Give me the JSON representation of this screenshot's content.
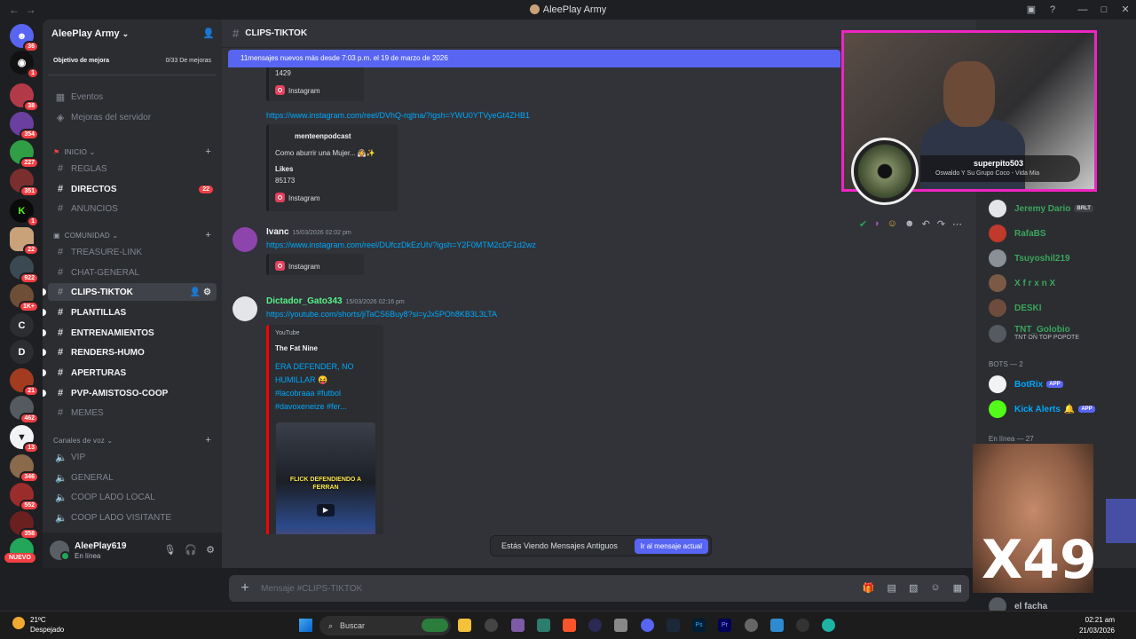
{
  "window": {
    "title": "AleePlay Army"
  },
  "server": {
    "name": "AleePlay Army",
    "boost_label": "Objetivo de mejora",
    "boost_progress": "0/33 De mejoras"
  },
  "sidebar": {
    "events": "Eventos",
    "improvements": "Mejoras del servidor",
    "cat_inicio": "INICIO",
    "cat_comunidad": "COMUNIDAD",
    "cat_voice": "Canales de voz",
    "channels": {
      "reglas": "REGLAS",
      "directos": "DIRECTOS",
      "directos_badge": "22",
      "anuncios": "ANUNCIOS",
      "treasure": "TREASURE-LINK",
      "chat": "CHAT-GENERAL",
      "clips": "CLIPS-TIKTOK",
      "plantillas": "PLANTILLAS",
      "entrenamientos": "ENTRENAMIENTOS",
      "renders": "RENDERS-HUMO",
      "aperturas": "APERTURAS",
      "pvp": "PVP-AMISTOSO-COOP",
      "memes": "MEMES"
    },
    "voice": {
      "vip": "VIP",
      "general": "GENERAL",
      "local": "COOP LADO LOCAL",
      "visitante": "COOP LADO VISITANTE"
    },
    "user": {
      "name": "AleePlay619",
      "status": "En línea"
    }
  },
  "guilds": {
    "badges": [
      "36",
      "1",
      "38",
      "354",
      "227",
      "351",
      "1",
      "22",
      "922",
      "1K+",
      "21",
      "462",
      "13",
      "346",
      "552",
      "358"
    ],
    "letters": [
      "C",
      "D"
    ],
    "nuevo": "NUEVO"
  },
  "channel": {
    "name": "CLIPS-TIKTOK",
    "new_banner": "11mensajes nuevos más desde 7:03 p.m. el 19 de marzo de 2026",
    "composer_placeholder": "Mensaje #CLIPS-TIKTOK",
    "toast_text": "Estás Viendo Mensajes Antiguos",
    "toast_button": "Ir al mensaje actual"
  },
  "messages": {
    "top_likes": "1429",
    "instagram": "Instagram",
    "link1": "https://www.instagram.com/reel/DVhQ-rqjtna/?igsh=YWU0YTVyeGt4ZHB1",
    "embed1_author": "menteenpodcast",
    "embed1_desc": "Como aburrir una Mujer... 👰‍♀️✨",
    "embed1_likes_label": "Likes",
    "embed1_likes": "85173",
    "m2_author": "Ivanc",
    "m2_time": "15/03/2026 02:02 pm",
    "link2": "https://www.instagram.com/reel/DUfczDkEzUh/?igsh=Y2F0MTM2cDF1d2wz",
    "m3_author": "Dictador_Gato343",
    "m3_time": "15/03/2026 02:16 pm",
    "link3": "https://youtube.com/shorts/jiTaCS6Buy8?si=yJx5POh8KB3L3LTA",
    "yt_provider": "YouTube",
    "yt_author": "The Fat Nine",
    "yt_title_1": "ERA DEFENDER, NO",
    "yt_title_2": "HUMILLAR 😝",
    "yt_title_3": "#lacobraaa #futbol",
    "yt_title_4": "#davoxeneize #fer...",
    "thumb_text": "FLICK DEFENDIENDO A FERRAN"
  },
  "members": {
    "rows": [
      {
        "name": "Jeremy Dario",
        "tag": "BRLT",
        "color": "#3ba55c"
      },
      {
        "name": "RafaBS",
        "color": "#3ba55c"
      },
      {
        "name": "Tsuyoshil219",
        "color": "#3ba55c"
      },
      {
        "name": "X f r x n X",
        "color": "#3ba55c"
      },
      {
        "name": "DESKI",
        "color": "#3ba55c"
      },
      {
        "name": "TNT_Golobio",
        "color": "#3ba55c",
        "sub": "TNT ON TOP POPOTE"
      }
    ],
    "bots_header": "BOTS — 2",
    "bots": [
      {
        "name": "BotRix",
        "tag": "APP"
      },
      {
        "name": "Kick Alerts",
        "tag": "APP"
      }
    ],
    "online_header": "En línea — 27",
    "last": "el facha"
  },
  "overlay": {
    "stream_user": "superpito503",
    "song": "Oswaldo Y Su Grupo Coco - Vida Mia",
    "meme_text": "X49"
  },
  "taskbar": {
    "temp": "21ºC",
    "weather": "Despejado",
    "search": "Buscar",
    "time": "02:21 am",
    "date": "21/03/2026"
  },
  "colors": {
    "accent": "#5865f2",
    "link": "#00a8fc",
    "danger": "#f23f43",
    "online": "#23a55a"
  }
}
